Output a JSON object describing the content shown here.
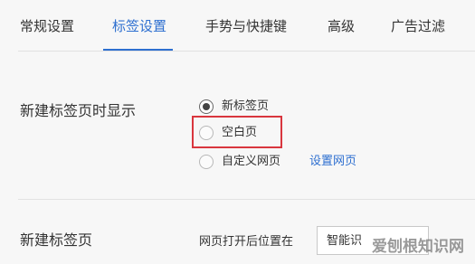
{
  "tabs": [
    {
      "label": "常规设置",
      "active": false
    },
    {
      "label": "标签设置",
      "active": true
    },
    {
      "label": "手势与快捷键",
      "active": false
    },
    {
      "label": "高级",
      "active": false
    },
    {
      "label": "广告过滤",
      "active": false
    }
  ],
  "new_tab_display": {
    "label": "新建标签页时显示",
    "options": [
      {
        "label": "新标签页",
        "checked": true
      },
      {
        "label": "空白页",
        "checked": false
      },
      {
        "label": "自定义网页",
        "checked": false
      }
    ],
    "set_page_link": "设置网页"
  },
  "new_tab": {
    "label": "新建标签页",
    "position_label": "网页打开后位置在",
    "position_value": "智能识"
  },
  "colors": {
    "accent": "#2d6fd0",
    "highlight": "#d9363e"
  },
  "watermark": "爱刨根知识网"
}
